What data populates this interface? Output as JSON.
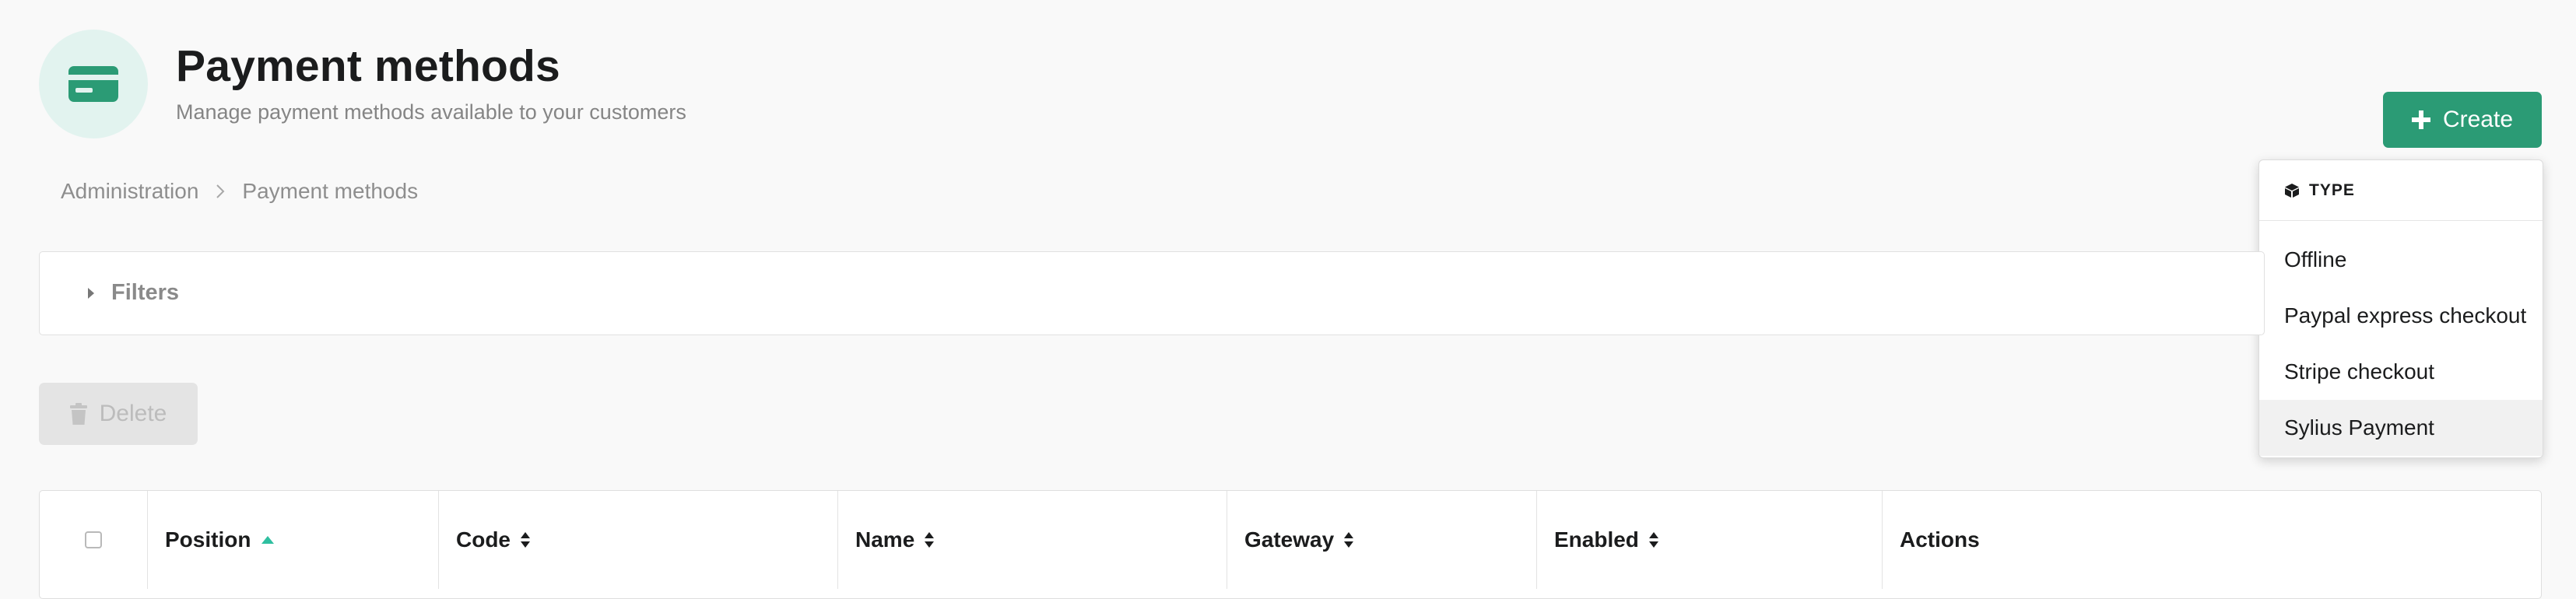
{
  "header": {
    "title": "Payment methods",
    "subtitle": "Manage payment methods available to your customers",
    "icon": "credit-card-icon",
    "accent_color": "#2b9b75"
  },
  "toolbar": {
    "create_label": "Create",
    "delete_label": "Delete"
  },
  "dropdown": {
    "header": "TYPE",
    "items": [
      "Offline",
      "Paypal express checkout",
      "Stripe checkout",
      "Sylius Payment"
    ],
    "highlighted": "Sylius Payment"
  },
  "breadcrumb": {
    "items": [
      "Administration",
      "Payment methods"
    ]
  },
  "filters": {
    "label": "Filters"
  },
  "table": {
    "columns": [
      "Position",
      "Code",
      "Name",
      "Gateway",
      "Enabled",
      "Actions"
    ],
    "sorted_column": "Position",
    "sort_direction": "ascending"
  }
}
